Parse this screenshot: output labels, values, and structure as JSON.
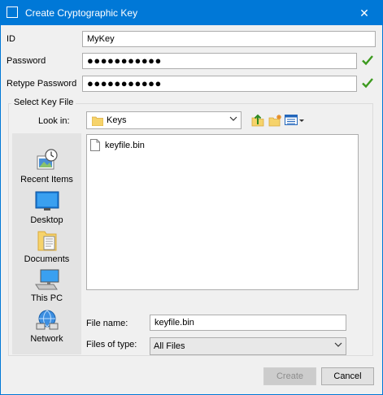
{
  "window": {
    "title": "Create Cryptographic Key",
    "close": "✕"
  },
  "form": {
    "id_label": "ID",
    "id_value": "MyKey",
    "password_label": "Password",
    "password_value": "●●●●●●●●●●●",
    "retype_label": "Retype Password",
    "retype_value": "●●●●●●●●●●●"
  },
  "keyfile": {
    "group_title": "Select Key File",
    "look_in_label": "Look in:",
    "look_in_value": "Keys",
    "places": [
      {
        "label": "Recent Items",
        "icon": "recent-items-icon"
      },
      {
        "label": "Desktop",
        "icon": "desktop-icon"
      },
      {
        "label": "Documents",
        "icon": "documents-icon"
      },
      {
        "label": "This PC",
        "icon": "this-pc-icon"
      },
      {
        "label": "Network",
        "icon": "network-icon"
      }
    ],
    "files": [
      {
        "name": "keyfile.bin",
        "icon": "file-icon"
      }
    ],
    "file_name_label": "File name:",
    "file_name_value": "keyfile.bin",
    "file_type_label": "Files of type:",
    "file_type_value": "All Files"
  },
  "buttons": {
    "create": "Create",
    "cancel": "Cancel"
  },
  "colors": {
    "title_bar": "#0078d7",
    "check": "#3c9a1e",
    "folder": "#f6d36b"
  }
}
